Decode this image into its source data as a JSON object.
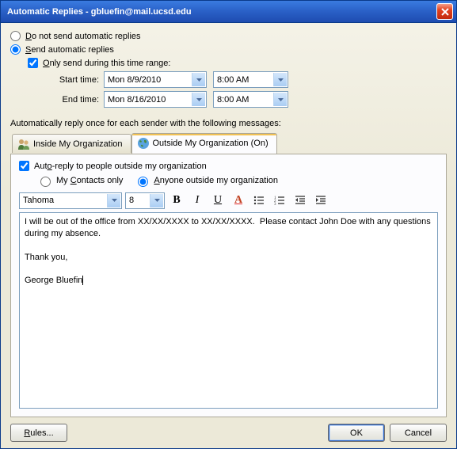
{
  "window": {
    "title": "Automatic Replies - gbluefin@mail.ucsd.edu"
  },
  "mode": {
    "do_not_send_label": "Do not send automatic replies",
    "send_label": "Send automatic replies",
    "selected": "send"
  },
  "time_range": {
    "only_send_label": "Only send during this time range:",
    "checked": true,
    "start_label": "Start time:",
    "end_label": "End time:",
    "start_date": "Mon 8/9/2010",
    "start_time": "8:00 AM",
    "end_date": "Mon 8/16/2010",
    "end_time": "8:00 AM"
  },
  "section_label": "Automatically reply once for each sender with the following messages:",
  "tabs": {
    "inside_label": "Inside My Organization",
    "outside_label": "Outside My Organization (On)",
    "active": "outside"
  },
  "outside": {
    "autoreply_label": "Auto-reply to people outside my organization",
    "autoreply_checked": true,
    "contacts_only_label": "My Contacts only",
    "anyone_label": "Anyone outside my organization",
    "scope_selected": "anyone"
  },
  "format": {
    "font": "Tahoma",
    "size": "8"
  },
  "message": {
    "body": "I will be out of the office from XX/XX/XXXX to XX/XX/XXXX.  Please contact John Doe with any questions during my absence.\n\nThank you,\n\nGeorge Bluefin"
  },
  "buttons": {
    "rules": "Rules...",
    "ok": "OK",
    "cancel": "Cancel"
  }
}
